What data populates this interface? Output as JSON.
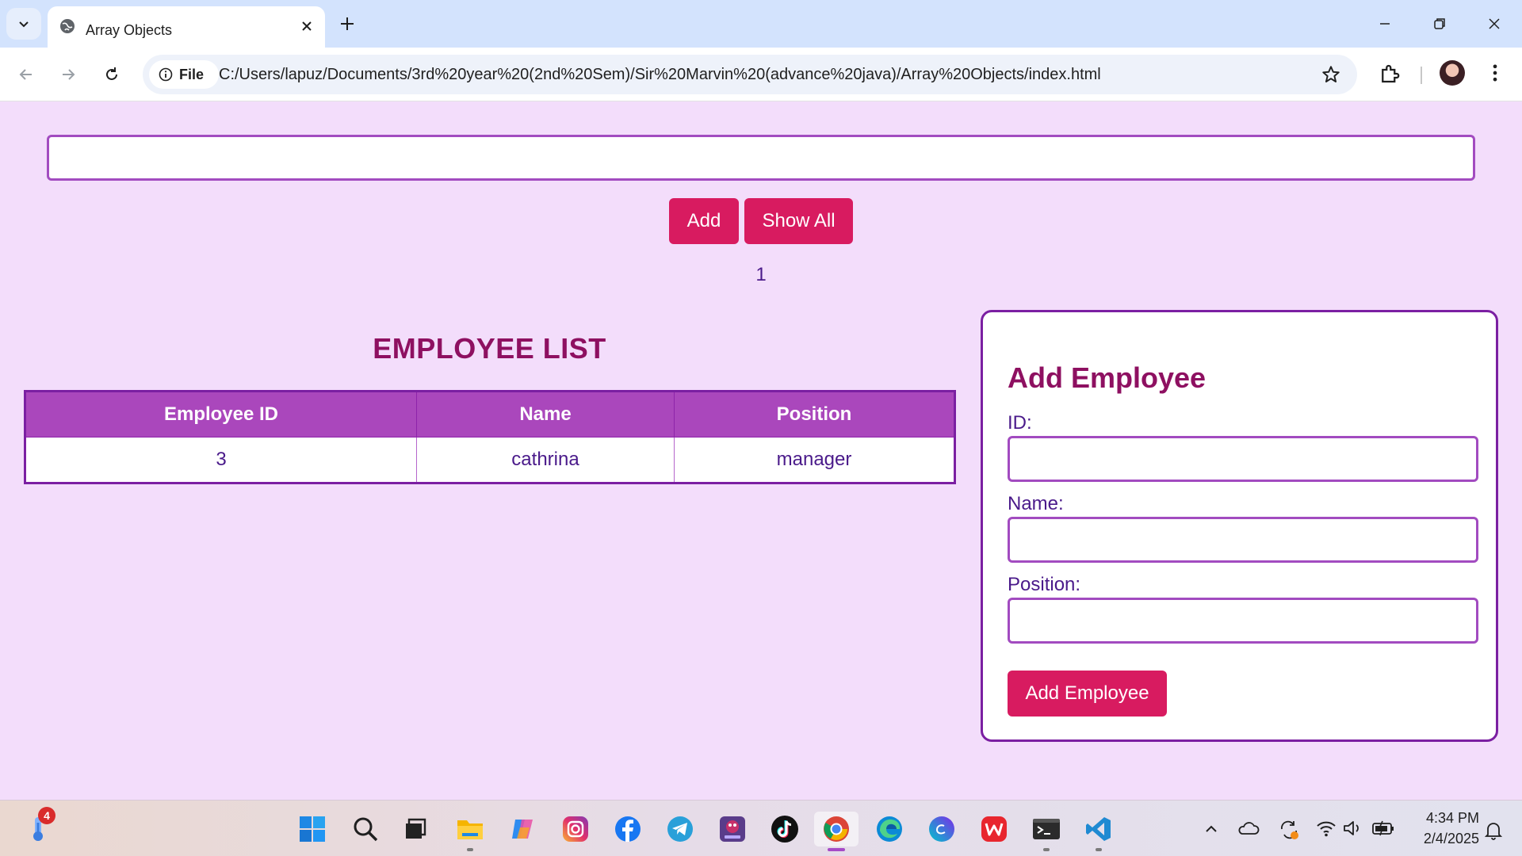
{
  "browser": {
    "tab_title": "Array Objects",
    "file_chip_label": "File",
    "url": "C:/Users/lapuz/Documents/3rd%20year%20(2nd%20Sem)/Sir%20Marvin%20(advance%20java)/Array%20Objects/index.html"
  },
  "page": {
    "main_input": {
      "value": "",
      "placeholder": ""
    },
    "add_button": "Add",
    "show_all_button": "Show All",
    "count": "1"
  },
  "employee_list": {
    "title": "EMPLOYEE LIST",
    "columns": [
      "Employee ID",
      "Name",
      "Position"
    ],
    "rows": [
      [
        "3",
        "cathrina",
        "manager"
      ]
    ]
  },
  "add_employee_form": {
    "title": "Add Employee",
    "id_label": "ID:",
    "name_label": "Name:",
    "position_label": "Position:",
    "submit_button": "Add Employee"
  },
  "taskbar": {
    "weather_badge": "4",
    "time": "4:34 PM",
    "date": "2/4/2025",
    "pinned_icons": [
      "start-icon",
      "search-icon",
      "task-view-icon",
      "file-explorer-icon",
      "copilot-icon",
      "instagram-icon",
      "facebook-icon",
      "telegram-icon",
      "game-app-icon",
      "tiktok-icon",
      "chrome-icon",
      "edge-icon",
      "canva-icon",
      "wps-office-icon",
      "terminal-icon",
      "vscode-icon"
    ]
  },
  "colors": {
    "page_background": "#f3ddfb",
    "accent_button": "#d81b60",
    "heading": "#8e1061",
    "table_header": "#aa47bc",
    "border_purple": "#7b1fa2"
  }
}
